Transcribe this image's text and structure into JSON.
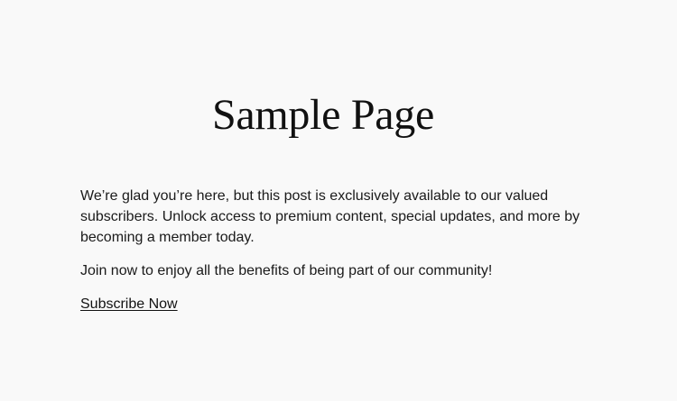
{
  "page": {
    "title": "Sample Page"
  },
  "content": {
    "paragraph_1": "We’re glad you’re here, but this post is exclusively available to our valued subscribers. Unlock access to premium content, special updates, and more by becoming a member today.",
    "paragraph_2": "Join now to enjoy all the benefits of being part of our community!",
    "subscribe_link": "Subscribe Now"
  }
}
